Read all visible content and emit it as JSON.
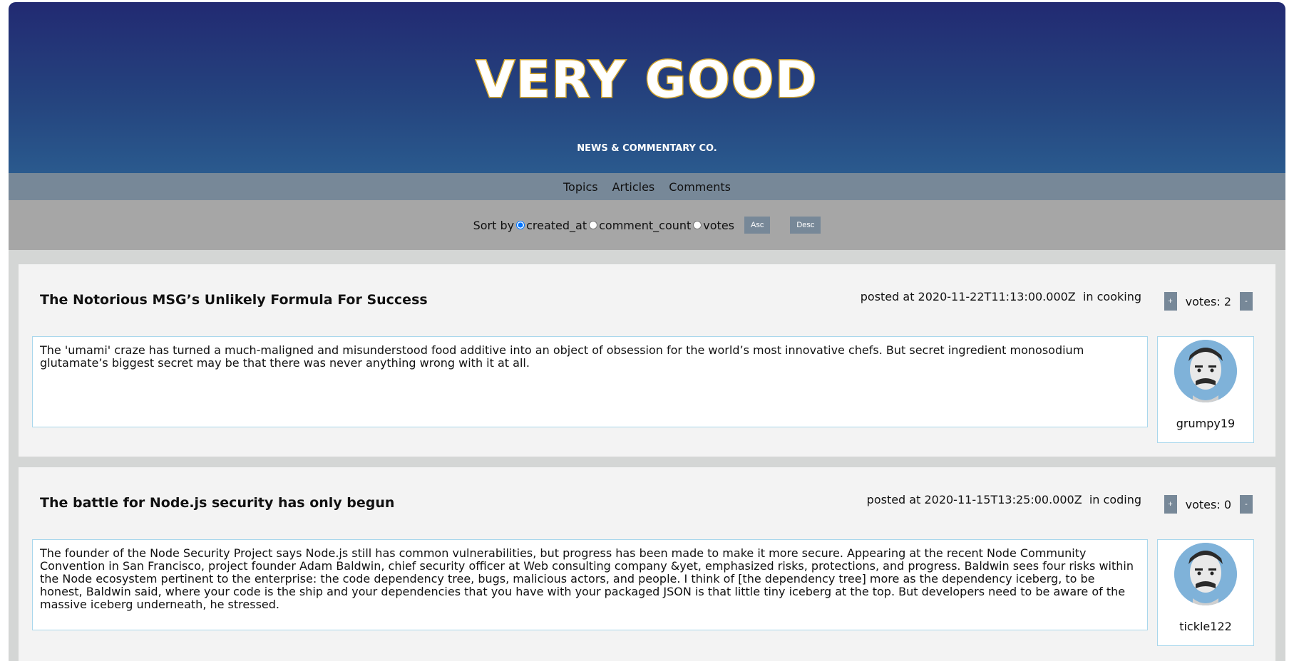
{
  "header": {
    "title": "VERY GOOD",
    "subtitle": "NEWS & COMMENTARY CO."
  },
  "nav": {
    "items": [
      "Topics",
      "Articles",
      "Comments"
    ]
  },
  "sort": {
    "label": "Sort by",
    "options": [
      "created_at",
      "comment_count",
      "votes"
    ],
    "selected": "created_at",
    "asc_label": "Asc",
    "desc_label": "Desc"
  },
  "articles": [
    {
      "title": "The Notorious MSG’s Unlikely Formula For Success",
      "posted": "posted at 2020-11-22T11:13:00.000Z",
      "topic": "in cooking",
      "votes": "votes: 2",
      "plus": "+",
      "minus": "-",
      "body": "The 'umami' craze has turned a much-maligned and misunderstood food additive into an object of obsession for the world’s most innovative chefs. But secret ingredient monosodium glutamate’s biggest secret may be that there was never anything wrong with it at all.",
      "author": "grumpy19"
    },
    {
      "title": "The battle for Node.js security has only begun",
      "posted": "posted at 2020-11-15T13:25:00.000Z",
      "topic": "in coding",
      "votes": "votes: 0",
      "plus": "+",
      "minus": "-",
      "body": "The founder of the Node Security Project says Node.js still has common vulnerabilities, but progress has been made to make it more secure. Appearing at the recent Node Community Convention in San Francisco, project founder Adam Baldwin, chief security officer at Web consulting company &yet, emphasized risks, protections, and progress. Baldwin sees four risks within the Node ecosystem pertinent to the enterprise: the code dependency tree, bugs, malicious actors, and people. I think of [the dependency tree] more as the dependency iceberg, to be honest, Baldwin said, where your code is the ship and your dependencies that you have with your packaged JSON is that little tiny iceberg at the top. But developers need to be aware of the massive iceberg underneath, he stressed.",
      "author": "tickle122"
    }
  ],
  "colors": {
    "header_top": "#222a72",
    "header_bottom": "#2a5a8e",
    "title_outline": "#d4a62c",
    "nav_bg": "#778898",
    "sort_bg": "#a6a6a6",
    "page_bg": "#d4d6d5",
    "card_bg": "#f3f3f3",
    "box_border": "#a9d7ec"
  }
}
